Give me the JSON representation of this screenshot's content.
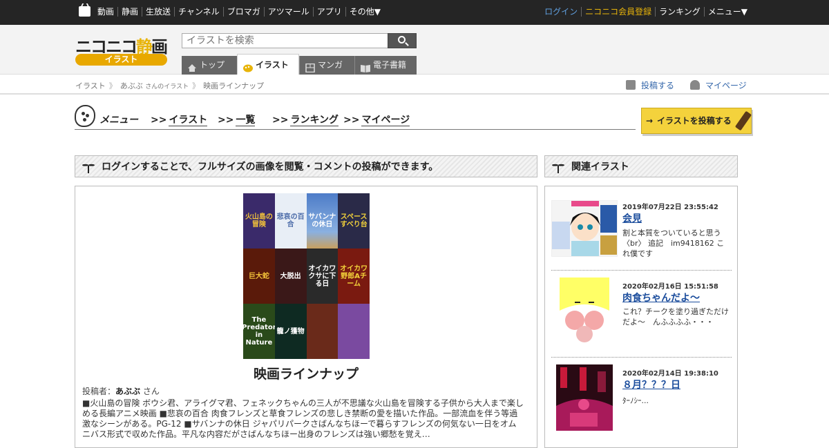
{
  "topnav": {
    "left": [
      "動画",
      "静画",
      "生放送",
      "チャンネル",
      "ブロマガ",
      "アツマール",
      "アプリ",
      "その他▼"
    ],
    "right": {
      "login": "ログイン",
      "register": "ニコニコ会員登録",
      "ranking": "ランキング",
      "menu": "メニュー▼"
    }
  },
  "logo": {
    "main_a": "ニコニコ",
    "main_b": "静",
    "main_c": "画",
    "sub": "イラスト"
  },
  "search": {
    "placeholder": "イラストを検索"
  },
  "tabs": [
    {
      "label": "トップ",
      "icon": "house-icon"
    },
    {
      "label": "イラスト",
      "icon": "illust-icon"
    },
    {
      "label": "マンガ",
      "icon": "manga-icon"
    },
    {
      "label": "電子書籍",
      "icon": "book-icon"
    }
  ],
  "breadcrumb": {
    "a": "イラスト",
    "b": "あぶぶ",
    "b_suffix": "さんのイラスト",
    "c": "映画ラインナップ",
    "sep": "》"
  },
  "header_links": {
    "post": "投稿する",
    "mypage": "マイページ"
  },
  "menu": {
    "label": "メニュー",
    "arrow": ">>",
    "items": [
      "イラスト",
      "一覧",
      "ランキング",
      "マイページ"
    ],
    "post_button": "イラストを投稿する"
  },
  "main": {
    "header": "ログインすることで、フルサイズの画像を閲覧・コメントの投稿ができます。",
    "title": "映画ラインナップ",
    "poster_label": "投稿者：",
    "poster_name": "あぶぶ",
    "poster_suffix": "さん",
    "description": "■火山島の冒険 ボウシ君、アライグマ君、フェネックちゃんの三人が不思議な火山島を冒険する子供から大人まで楽しめる長編アニメ映画 ■悲哀の百合 肉食フレンズと草食フレンズの悲しき禁断の愛を描いた作品。一部流血を伴う等過激なシーンがある。PG-12 ■サバンナの休日 ジャパリパークさばんなちほーで暮らすフレンズの何気ない一日をオムニバス形式で収めた作品。平凡な内容だがさばんなちほー出身のフレンズは強い郷愁を覚え…",
    "tiles": [
      {
        "text": "火山島の冒険",
        "color": "#3a2a6a"
      },
      {
        "text": "悲哀の百合",
        "color": "#e8eef6"
      },
      {
        "text": "サバンナの休日",
        "color": "#4d7cc8"
      },
      {
        "text": "スペースすべり台",
        "color": "#2a2a48"
      },
      {
        "text": "巨大蛇",
        "color": "#5a1a0a"
      },
      {
        "text": "大脱出",
        "color": "#3a1818"
      },
      {
        "text": "オイカワクサに下る日",
        "color": "#2a2a2a"
      },
      {
        "text": "オイカワ野郎Aチーム",
        "color": "#7a1a10"
      },
      {
        "text": "The Predator in Nature",
        "color": "#2a4a1a"
      },
      {
        "text": "籠ノ獲物",
        "color": "#0e2a22"
      },
      {
        "text": "",
        "color": "#6a2a1a"
      },
      {
        "text": "",
        "color": "#7a4aa0"
      }
    ]
  },
  "sidebar": {
    "header": "関連イラスト",
    "items": [
      {
        "date": "2019年07月22日 23:55:42",
        "title": "会見",
        "desc": "割と本質をついていると思う〈br〉 追記　im9418162 これ僕です"
      },
      {
        "date": "2020年02月16日 15:51:58",
        "title": "肉食ちゃんだよ〜",
        "desc": "これ？チークを塗り過ぎただけだよ〜　んふふふふ・・・"
      },
      {
        "date": "2020年02月14日 19:38:10",
        "title": "８月？？？日",
        "desc": "ﾀｰﾉｼｰ..."
      }
    ]
  },
  "colors": {
    "accent": "#e8b40a",
    "link": "#1a4c9c",
    "topbar": "#252525"
  }
}
